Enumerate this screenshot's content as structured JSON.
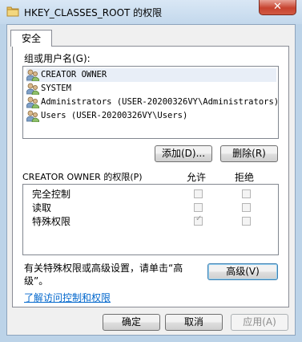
{
  "window": {
    "title": "HKEY_CLASSES_ROOT 的权限",
    "close_label": "✕"
  },
  "tabs": [
    {
      "label": "安全"
    }
  ],
  "groups": {
    "label": "组或用户名(G):",
    "items": [
      {
        "name": "CREATOR OWNER"
      },
      {
        "name": "SYSTEM"
      },
      {
        "name": "Administrators (USER-20200326VY\\Administrators)"
      },
      {
        "name": "Users (USER-20200326VY\\Users)"
      }
    ],
    "add_button": "添加(D)...",
    "remove_button": "删除(R)"
  },
  "permissions": {
    "label": "CREATOR OWNER 的权限(P)",
    "allow_header": "允许",
    "deny_header": "拒绝",
    "rows": [
      {
        "name": "完全控制",
        "allow": false,
        "deny": false
      },
      {
        "name": "读取",
        "allow": false,
        "deny": false
      },
      {
        "name": "特殊权限",
        "allow": true,
        "deny": false
      }
    ]
  },
  "advanced": {
    "text": "有关特殊权限或高级设置，请单击“高级”。",
    "button": "高级(V)"
  },
  "learn_link": "了解访问控制和权限",
  "footer": {
    "ok": "确定",
    "cancel": "取消",
    "apply": "应用(A)"
  }
}
